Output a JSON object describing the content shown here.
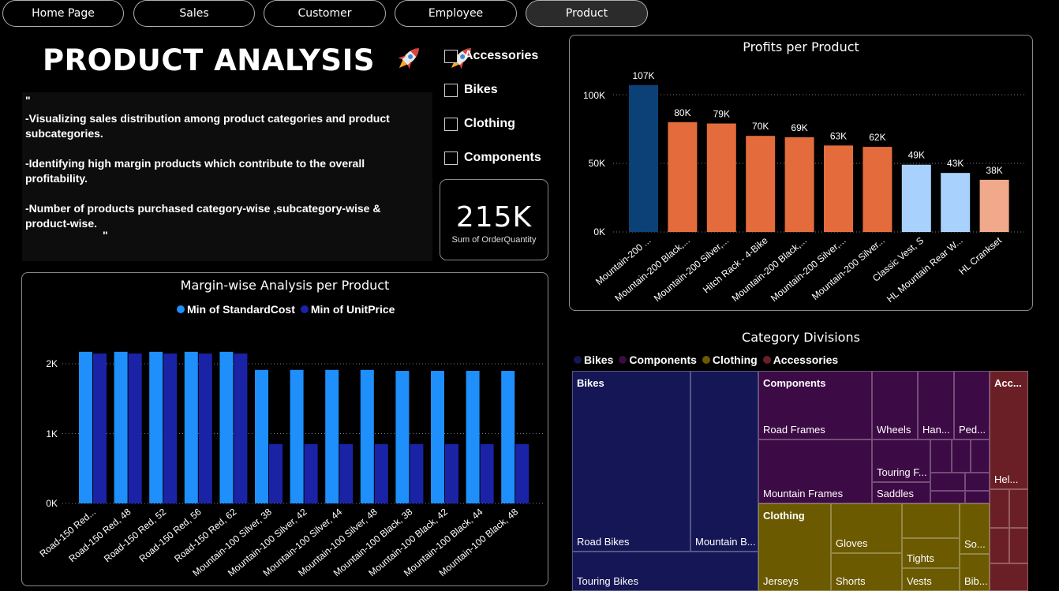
{
  "nav": [
    {
      "label": "Home Page",
      "active": false
    },
    {
      "label": "Sales",
      "active": false
    },
    {
      "label": "Customer",
      "active": false
    },
    {
      "label": "Employee",
      "active": false
    },
    {
      "label": "Product",
      "active": true
    }
  ],
  "page_title": "PRODUCT ANALYSIS",
  "title_icons": [
    "rocket-icon",
    "rocket-icon"
  ],
  "description": {
    "open_quote": "\"",
    "lines": [
      "-Visualizing sales distribution among product categories and product subcategories.",
      "-Identifying high margin products which contribute to the overall profitability.",
      "-Number of products purchased category-wise ,subcategory-wise & product-wise."
    ],
    "close_quote": "\""
  },
  "slicer": {
    "options": [
      {
        "label": "Accessories",
        "checked": false
      },
      {
        "label": "Bikes",
        "checked": false
      },
      {
        "label": "Clothing",
        "checked": false
      },
      {
        "label": "Components",
        "checked": false
      }
    ]
  },
  "kpi": {
    "value": "215K",
    "label": "Sum of OrderQuantity"
  },
  "profits_chart": {
    "title": "Profits per Product",
    "y_ticks": [
      "100K",
      "50K",
      "0K"
    ]
  },
  "margin_chart": {
    "title": "Margin-wise Analysis per Product",
    "legend": [
      "Min of StandardCost",
      "Min of UnitPrice"
    ],
    "y_ticks": [
      "2K",
      "1K",
      "0K"
    ]
  },
  "treemap": {
    "title": "Category Divisions",
    "legend": [
      {
        "label": "Bikes",
        "color": "#141655"
      },
      {
        "label": "Components",
        "color": "#3c0a44"
      },
      {
        "label": "Clothing",
        "color": "#6b5a00"
      },
      {
        "label": "Accessories",
        "color": "#6a1f26"
      }
    ],
    "headers": [
      "Bikes",
      "Components",
      "Clothing",
      "Acc..."
    ],
    "labels": {
      "road_bikes": "Road Bikes",
      "mountain_bikes": "Mountain B...",
      "touring_bikes": "Touring Bikes",
      "road_frames": "Road Frames",
      "wheels": "Wheels",
      "handlebars": "Han...",
      "pedals": "Ped...",
      "touring_frames": "Touring F...",
      "mountain_frames": "Mountain Frames",
      "saddles": "Saddles",
      "gloves": "Gloves",
      "socks": "So...",
      "tights": "Tights",
      "jerseys": "Jerseys",
      "shorts": "Shorts",
      "vests": "Vests",
      "bib_shorts": "Bib...",
      "helmets": "Hel..."
    }
  },
  "chart_data": [
    {
      "type": "bar",
      "title": "Profits per Product",
      "categories": [
        "Mountain-200 ...",
        "Mountain-200 Black,...",
        "Mountain-200 Silver,...",
        "Hitch Rack - 4-Bike",
        "Mountain-200 Black,...",
        "Mountain-200 Silver,...",
        "Mountain-200 Silver...",
        "Classic Vest, S",
        "HL Mountain Rear W...",
        "HL Crankset"
      ],
      "values": [
        107000,
        80000,
        79000,
        70000,
        69000,
        63000,
        62000,
        49000,
        43000,
        38000
      ],
      "data_labels": [
        "107K",
        "80K",
        "79K",
        "70K",
        "69K",
        "63K",
        "62K",
        "49K",
        "43K",
        "38K"
      ],
      "colors": [
        "#0c4177",
        "#e46c3c",
        "#e46c3c",
        "#e46c3c",
        "#e46c3c",
        "#e46c3c",
        "#e46c3c",
        "#a8d2fd",
        "#a8d2fd",
        "#f0a98a"
      ],
      "ylim": [
        0,
        110000
      ],
      "grid": true
    },
    {
      "type": "bar",
      "title": "Margin-wise Analysis per Product",
      "categories": [
        "Road-150 Red...",
        "Road-150 Red, 48",
        "Road-150 Red, 52",
        "Road-150 Red, 56",
        "Road-150 Red, 62",
        "Mountain-100 Silver, 38",
        "Mountain-100 Silver, 42",
        "Mountain-100 Silver, 44",
        "Mountain-100 Silver, 48",
        "Mountain-100 Black, 38",
        "Mountain-100 Black, 42",
        "Mountain-100 Black, 44",
        "Mountain-100 Black, 48"
      ],
      "series": [
        {
          "name": "Min of StandardCost",
          "color": "#1f8ffb",
          "values": [
            2171,
            2171,
            2171,
            2171,
            2171,
            1912,
            1912,
            1912,
            1912,
            1898,
            1898,
            1898,
            1898
          ]
        },
        {
          "name": "Min of UnitPrice",
          "color": "#1a23a6",
          "values": [
            2146,
            2146,
            2146,
            2146,
            2146,
            850,
            850,
            850,
            850,
            850,
            850,
            850,
            850
          ]
        }
      ],
      "ylim": [
        0,
        2450
      ],
      "legend": "top-center",
      "grid": true
    }
  ]
}
